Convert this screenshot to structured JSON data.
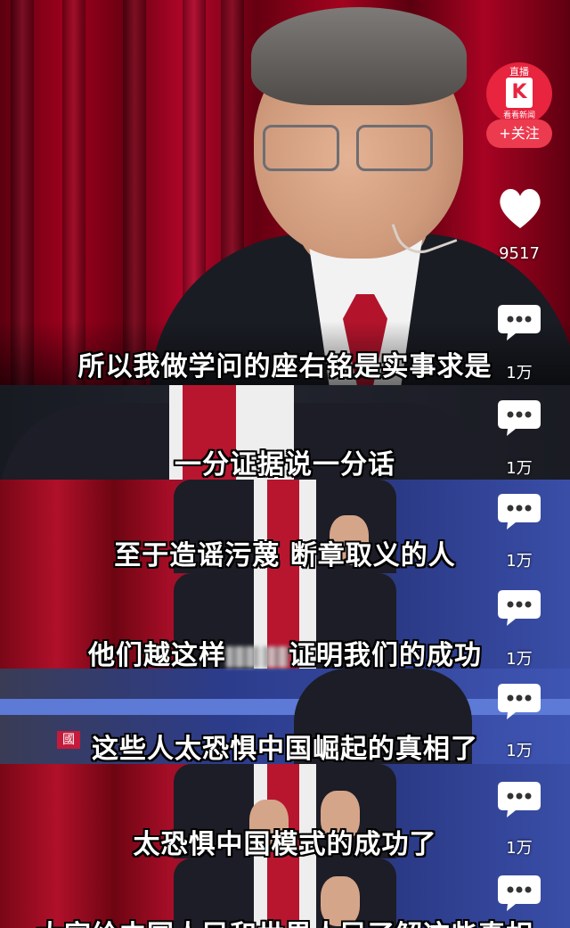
{
  "account": {
    "live_label": "直播",
    "logo_letter": "K",
    "name": "看看新闻",
    "follow_label": "+关注",
    "brand_color": "#e8243f"
  },
  "likes": {
    "count": "9517",
    "icon": "heart-icon"
  },
  "comments": [
    {
      "icon": "comment-icon",
      "count": "1万"
    },
    {
      "icon": "comment-icon",
      "count": "1万"
    },
    {
      "icon": "comment-icon",
      "count": "1万"
    },
    {
      "icon": "comment-icon",
      "count": "1万"
    },
    {
      "icon": "comment-icon",
      "count": "1万"
    },
    {
      "icon": "comment-icon",
      "count": "1万"
    }
  ],
  "tv_logo": "國",
  "subtitles": [
    "所以我做学问的座右铭是实事求是",
    "一分证据说一分话",
    "至于造谣污蔑 断章取义的人",
    "他们越这样",
    "证明我们的成功",
    "这些人太恐惧中国崛起的真相了",
    "太恐惧中国模式的成功了",
    "大家给中国人民和世界人民了解这些真相"
  ]
}
